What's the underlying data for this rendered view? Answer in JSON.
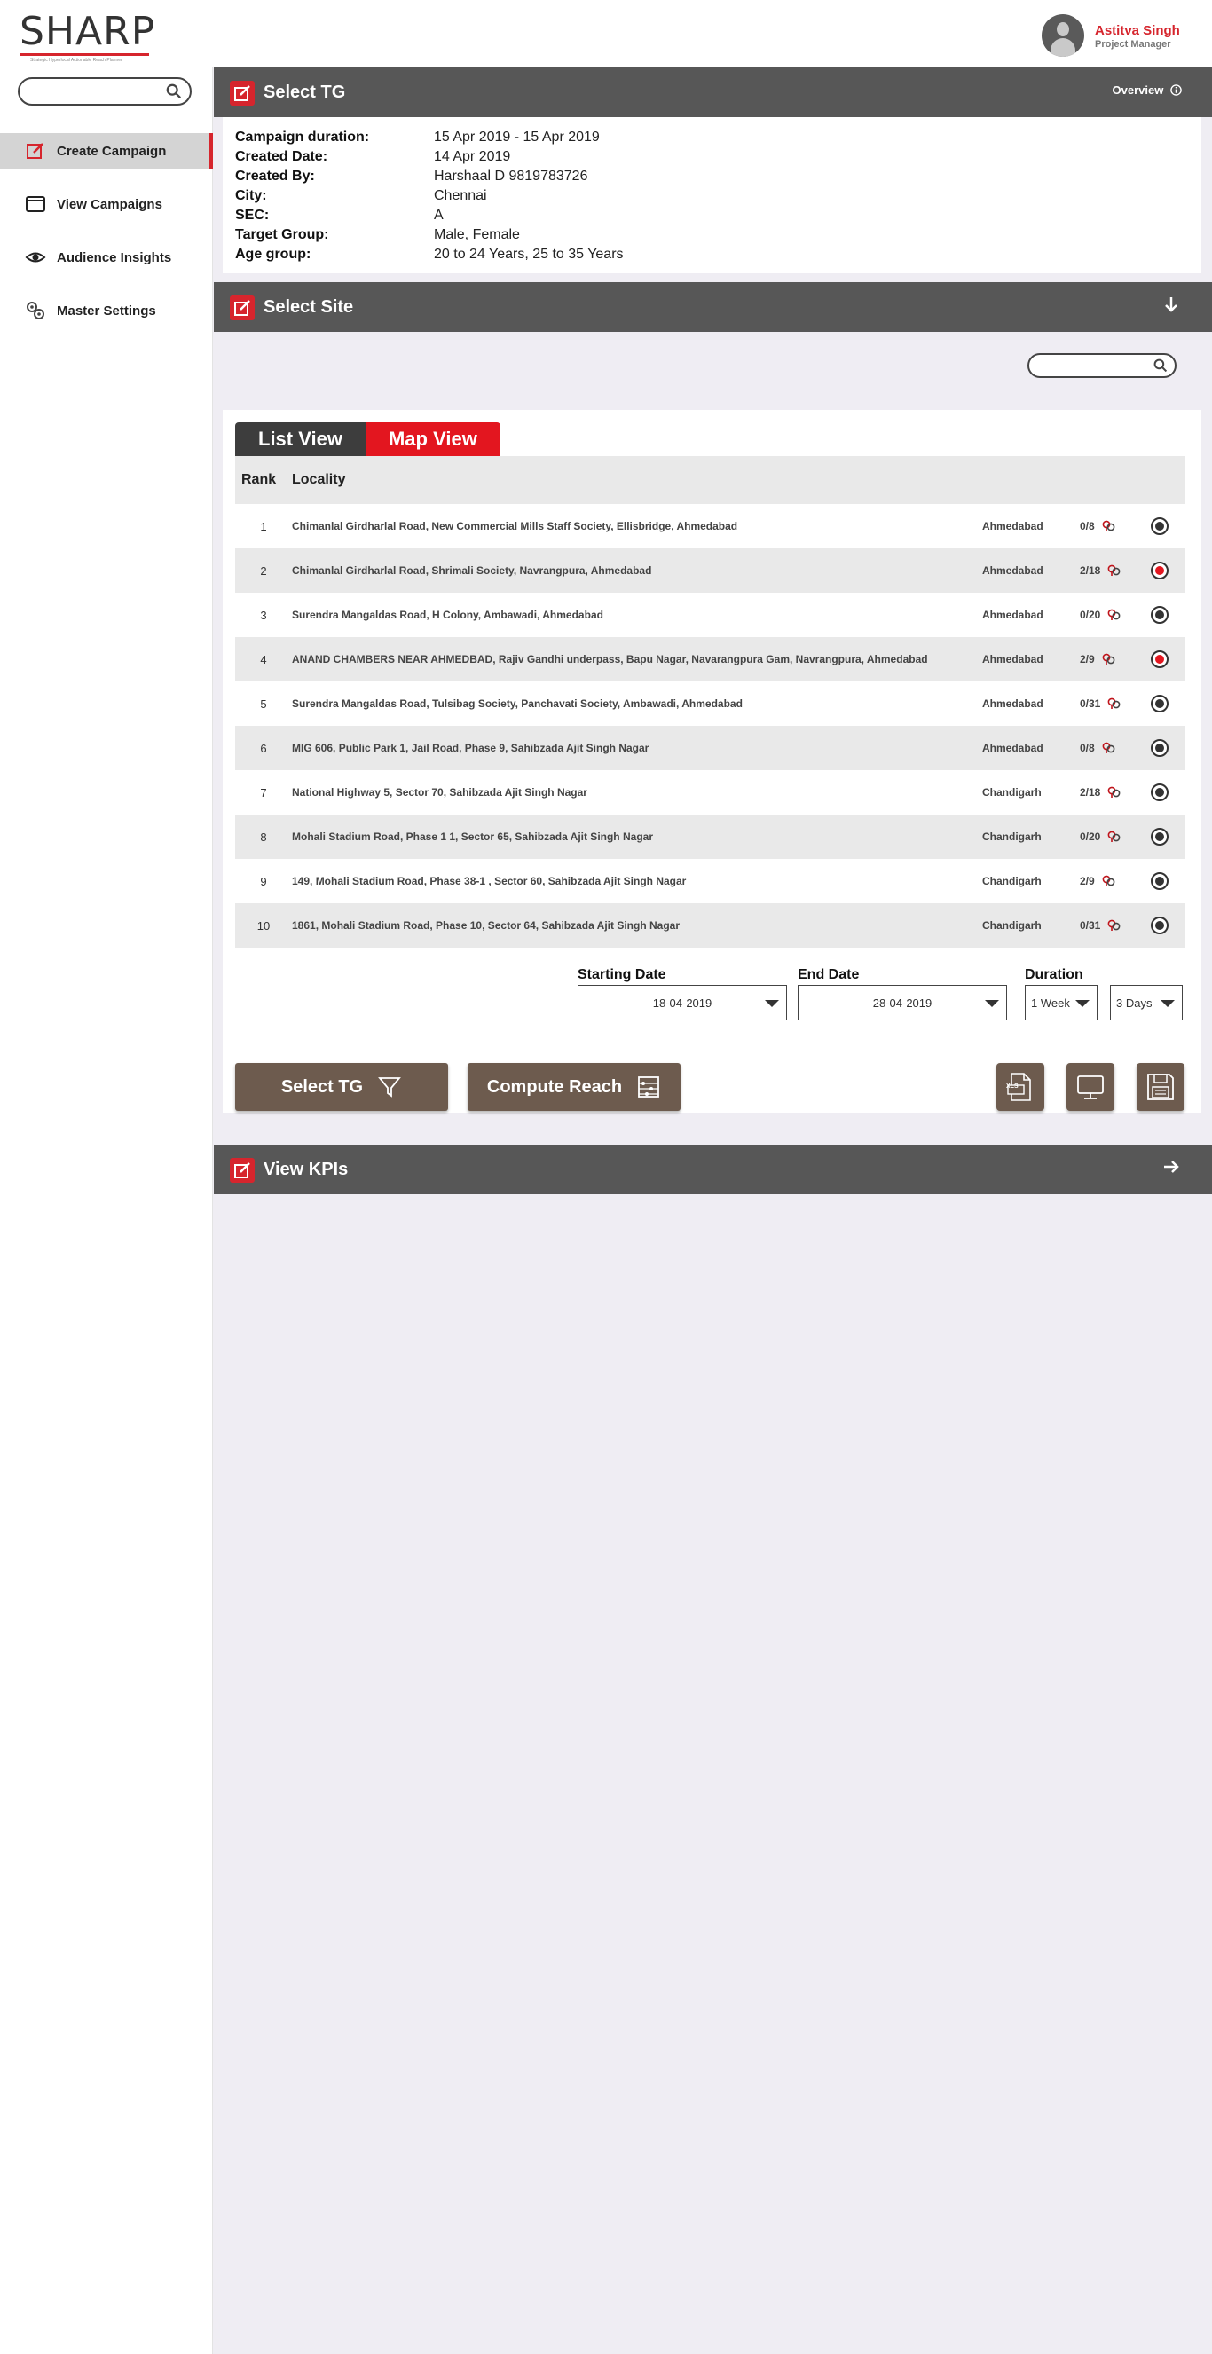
{
  "brand": {
    "name": "SHARP",
    "tagline": "Strategic Hyperlocal Actionable Reach Planner"
  },
  "user": {
    "name": "Astitva Singh",
    "role": "Project Manager"
  },
  "sidebar": {
    "search_placeholder": "",
    "items": [
      {
        "label": "Create Campaign",
        "icon": "edit-icon",
        "active": true
      },
      {
        "label": "View Campaigns",
        "icon": "window-icon",
        "active": false
      },
      {
        "label": "Audience Insights",
        "icon": "eye-icon",
        "active": false
      },
      {
        "label": "Master Settings",
        "icon": "gears-icon",
        "active": false
      }
    ]
  },
  "select_tg": {
    "title": "Select TG",
    "overview": "Overview",
    "fields": [
      {
        "key": "Campaign duration:",
        "value": "15 Apr 2019 - 15 Apr 2019"
      },
      {
        "key": "Created Date:",
        "value": " 14 Apr 2019"
      },
      {
        "key": "Created By:",
        "value": " Harshaal D  9819783726"
      },
      {
        "key": "City:",
        "value": " Chennai"
      },
      {
        "key": "SEC:",
        "value": "A"
      },
      {
        "key": "Target Group:",
        "value": "Male, Female"
      },
      {
        "key": "Age group:",
        "value": "20 to 24 Years, 25 to 35 Years"
      }
    ]
  },
  "select_site": {
    "title": "Select Site",
    "search_placeholder": "",
    "tabs": {
      "list": "List View",
      "map": "Map View"
    },
    "columns": {
      "rank": "Rank",
      "locality": "Locality"
    },
    "rows": [
      {
        "rank": "1",
        "locality": "Chimanlal Girdharlal Road, New Commercial Mills Staff Society, Ellisbridge, Ahmedabad",
        "city": "Ahmedabad",
        "count": "0/8",
        "selected": false
      },
      {
        "rank": "2",
        "locality": "Chimanlal Girdharlal Road, Shrimali Society, Navrangpura, Ahmedabad",
        "city": "Ahmedabad",
        "count": "2/18",
        "selected": true
      },
      {
        "rank": "3",
        "locality": "Surendra Mangaldas Road, H Colony, Ambawadi, Ahmedabad",
        "city": "Ahmedabad",
        "count": "0/20",
        "selected": false
      },
      {
        "rank": "4",
        "locality": "ANAND CHAMBERS NEAR AHMEDBAD, Rajiv Gandhi underpass, Bapu Nagar, Navarangpura Gam, Navrangpura, Ahmedabad",
        "city": "Ahmedabad",
        "count": "2/9",
        "selected": true
      },
      {
        "rank": "5",
        "locality": "Surendra Mangaldas Road, Tulsibag Society, Panchavati Society, Ambawadi, Ahmedabad",
        "city": "Ahmedabad",
        "count": "0/31",
        "selected": false
      },
      {
        "rank": "6",
        "locality": "MIG 606, Public Park 1, Jail Road, Phase 9, Sahibzada Ajit Singh Nagar",
        "city": "Ahmedabad",
        "count": "0/8",
        "selected": false
      },
      {
        "rank": "7",
        "locality": "National Highway 5, Sector 70, Sahibzada Ajit Singh Nagar",
        "city": "Chandigarh",
        "count": "2/18",
        "selected": false
      },
      {
        "rank": "8",
        "locality": "Mohali Stadium Road, Phase 1 1, Sector 65, Sahibzada Ajit Singh Nagar",
        "city": "Chandigarh",
        "count": "0/20",
        "selected": false
      },
      {
        "rank": "9",
        "locality": "149, Mohali Stadium Road, Phase 38-1 , Sector 60, Sahibzada Ajit Singh Nagar",
        "city": "Chandigarh",
        "count": "2/9",
        "selected": false
      },
      {
        "rank": "10",
        "locality": "1861, Mohali Stadium Road, Phase 10, Sector 64, Sahibzada Ajit Singh Nagar",
        "city": "Chandigarh",
        "count": "0/31",
        "selected": false
      }
    ],
    "starting_date": {
      "label": "Starting Date",
      "value": "18-04-2019"
    },
    "end_date": {
      "label": "End Date",
      "value": "28-04-2019"
    },
    "duration": {
      "label": "Duration",
      "value1": "1 Week",
      "value2": "3 Days"
    },
    "buttons": {
      "select_tg": "Select TG",
      "compute_reach": "Compute Reach",
      "xls": "XLS"
    }
  },
  "view_kpis": {
    "title": "View KPIs"
  },
  "colors": {
    "accent": "#e3161f",
    "header": "#575757",
    "button": "#6d5b4e"
  }
}
